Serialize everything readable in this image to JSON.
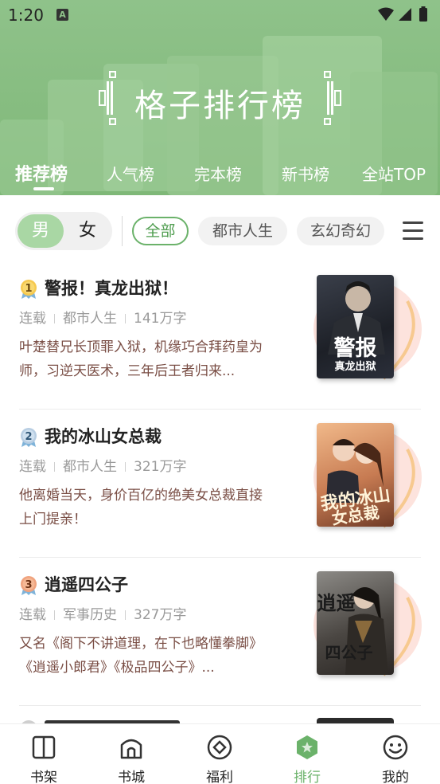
{
  "status_bar": {
    "time": "1:20",
    "notification_letter": "A"
  },
  "header": {
    "title": "格子排行榜",
    "tabs": [
      {
        "label": "推荐榜",
        "active": true
      },
      {
        "label": "人气榜",
        "active": false
      },
      {
        "label": "完本榜",
        "active": false
      },
      {
        "label": "新书榜",
        "active": false
      },
      {
        "label": "全站TOP",
        "active": false
      }
    ]
  },
  "filters": {
    "gender": {
      "male": "男",
      "female": "女",
      "selected": "男"
    },
    "categories": [
      {
        "label": "全部",
        "active": true
      },
      {
        "label": "都市人生",
        "active": false
      },
      {
        "label": "玄幻奇幻",
        "active": false
      }
    ]
  },
  "books": [
    {
      "rank": "1",
      "title": "警报！真龙出狱！",
      "status": "连载",
      "category": "都市人生",
      "words": "141万字",
      "description": "叶楚替兄长顶罪入狱，机缘巧合拜药皇为师，习逆天医术，三年后王者归来...",
      "cover_text_main": "警报",
      "cover_text_sub": "真龙出狱"
    },
    {
      "rank": "2",
      "title": "我的冰山女总裁",
      "status": "连载",
      "category": "都市人生",
      "words": "321万字",
      "description": "他离婚当天，身价百亿的绝美女总裁直接上门提亲！",
      "cover_text_main": "我的冰山",
      "cover_text_sub": "女总裁"
    },
    {
      "rank": "3",
      "title": "逍遥四公子",
      "status": "连载",
      "category": "军事历史",
      "words": "327万字",
      "description": "又名《阁下不讲道理，在下也略懂拳脚》《逍遥小郎君》《极品四公子》...",
      "cover_text_main": "逍遥",
      "cover_text_sub": "四公子"
    }
  ],
  "bottom_nav": [
    {
      "label": "书架",
      "icon": "book-open-icon",
      "active": false
    },
    {
      "label": "书城",
      "icon": "bookstore-icon",
      "active": false
    },
    {
      "label": "福利",
      "icon": "diamond-icon",
      "active": false
    },
    {
      "label": "排行",
      "icon": "ranking-star-icon",
      "active": true
    },
    {
      "label": "我的",
      "icon": "smiley-icon",
      "active": false
    }
  ],
  "colors": {
    "header_green": "#8fc28a",
    "accent_green": "#6bb26a",
    "description_brown": "#7a4e45"
  }
}
